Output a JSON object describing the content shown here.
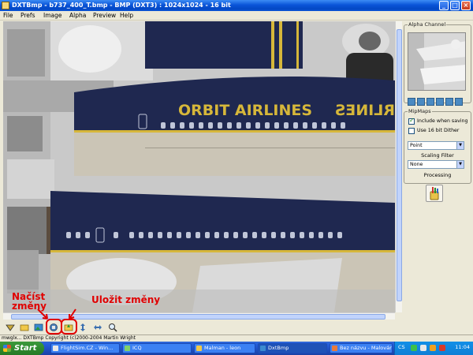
{
  "window": {
    "title": "DXTBmp - b737_400_T.bmp - BMP (DXT3) : 1024x1024 - 16 bit",
    "controls": {
      "minimize": "_",
      "maximize": "□",
      "close": "×"
    }
  },
  "menu": [
    "File",
    "Prefs",
    "Image",
    "Alpha",
    "Preview",
    "Help"
  ],
  "texture": {
    "livery_text": "ORBIT AIRLINES",
    "livery_text_mirrored": "RLINES",
    "colors": {
      "fuselage_blue": "#1f2850",
      "cheatline_gold": "#d6b73a",
      "belly_grey": "#cbc5b6"
    }
  },
  "panel": {
    "alpha_channel": "Alpha Channel",
    "mipmaps": "MipMaps",
    "include_when_saving": {
      "label": "Include when saving",
      "checked": true
    },
    "use_16bit_dither": {
      "label": "Use 16 bit Dither",
      "checked": false
    },
    "filter_select": "Point",
    "scaling_filter": "Scaling Filter",
    "scaling_select": "None",
    "processing": "Processing"
  },
  "annotations": {
    "load": "Načíst\nzměny",
    "save": "Uložit změny"
  },
  "status": "mwglx... DXTBmp Copyright (c)2000-2004 Martin Wright",
  "taskbar": {
    "start": "Start",
    "tasks": [
      "FlightSim.CZ - Win...",
      "ICQ",
      "Malman - leon",
      "DxtBmp",
      "Bez názvu - Malování"
    ],
    "lang": "CS",
    "clock": "11:04"
  }
}
